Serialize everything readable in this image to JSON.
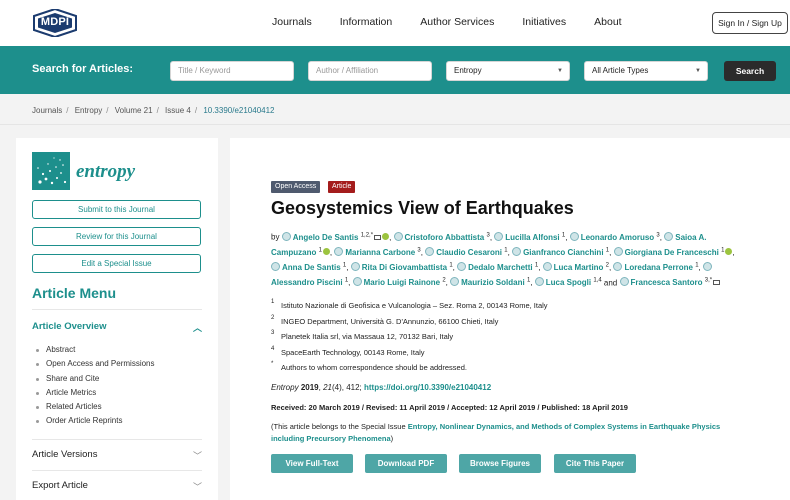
{
  "header": {
    "logo_text": "MDPI",
    "nav": [
      "Journals",
      "Information",
      "Author Services",
      "Initiatives",
      "About"
    ],
    "signin_label": "Sign In / Sign Up"
  },
  "search": {
    "label": "Search for Articles:",
    "title_placeholder": "Title / Keyword",
    "author_placeholder": "Author / Affiliation",
    "journal_value": "Entropy",
    "type_value": "All Article Types",
    "button_label": "Search"
  },
  "breadcrumb": {
    "items": [
      "Journals",
      "Entropy",
      "Volume 21",
      "Issue 4"
    ],
    "doi": "10.3390/e21040412"
  },
  "sidebar": {
    "journal_name": "entropy",
    "buttons": [
      "Submit to this Journal",
      "Review for this Journal",
      "Edit a Special Issue"
    ],
    "menu_title": "Article Menu",
    "overview_label": "Article Overview",
    "overview_items": [
      "Abstract",
      "Open Access and Permissions",
      "Share and Cite",
      "Article Metrics",
      "Related Articles",
      "Order Article Reprints"
    ],
    "versions_label": "Article Versions",
    "export_label": "Export Article"
  },
  "article": {
    "badge_oa": "Open Access",
    "badge_type": "Article",
    "title": "Geosystemics View of Earthquakes",
    "by": "by",
    "authors": [
      {
        "name": "Angelo De Santis",
        "sup": "1,2,*"
      },
      {
        "name": "Cristoforo Abbattista",
        "sup": "3"
      },
      {
        "name": "Lucilla Alfonsi",
        "sup": "1"
      },
      {
        "name": "Leonardo Amoruso",
        "sup": "3"
      },
      {
        "name": "Saioa A. Campuzano",
        "sup": "1"
      },
      {
        "name": "Marianna Carbone",
        "sup": "3"
      },
      {
        "name": "Claudio Cesaroni",
        "sup": "1"
      },
      {
        "name": "Gianfranco Cianchini",
        "sup": "1"
      },
      {
        "name": "Giorgiana De Franceschi",
        "sup": "1"
      },
      {
        "name": "Anna De Santis",
        "sup": "1"
      },
      {
        "name": "Rita Di Giovambattista",
        "sup": "1"
      },
      {
        "name": "Dedalo Marchetti",
        "sup": "1"
      },
      {
        "name": "Luca Martino",
        "sup": "2"
      },
      {
        "name": "Loredana Perrone",
        "sup": "1"
      },
      {
        "name": "Alessandro Piscini",
        "sup": "1"
      },
      {
        "name": "Mario Luigi Rainone",
        "sup": "2"
      },
      {
        "name": "Maurizio Soldani",
        "sup": "1"
      },
      {
        "name": "Luca Spogli",
        "sup": "1,4"
      },
      {
        "name": "Francesca Santoro",
        "sup": "3,*"
      }
    ],
    "and_word": "and",
    "affiliations": [
      {
        "num": "1",
        "text": "Istituto Nazionale di Geofisica e Vulcanologia – Sez. Roma 2, 00143 Rome, Italy"
      },
      {
        "num": "2",
        "text": "INGEO Department, Università G. D'Annunzio, 66100 Chieti, Italy"
      },
      {
        "num": "3",
        "text": "Planetek Italia srl, via Massaua 12, 70132 Bari, Italy"
      },
      {
        "num": "4",
        "text": "SpaceEarth Technology, 00143 Rome, Italy"
      },
      {
        "num": "*",
        "text": "Authors to whom correspondence should be addressed."
      }
    ],
    "citation": {
      "journal": "Entropy",
      "year": "2019",
      "volume": "21",
      "issue_page": "(4), 412; ",
      "doi_link": "https://doi.org/10.3390/e21040412"
    },
    "dates": "Received: 20 March 2019 / Revised: 11 April 2019 / Accepted: 12 April 2019 / Published: 18 April 2019",
    "special_prefix": "(This article belongs to the Special Issue ",
    "special_issue": "Entropy, Nonlinear Dynamics, and Methods of Complex Systems in Earthquake Physics including Precursory Phenomena",
    "special_suffix": ")",
    "actions": [
      "View Full-Text",
      "Download PDF",
      "Browse Figures",
      "Cite This Paper"
    ]
  },
  "colors": {
    "brand_teal": "#1d8f8c",
    "button_teal": "#4ea6a6",
    "open_access_badge": "#4f5a6e",
    "article_badge": "#a41c1c"
  }
}
